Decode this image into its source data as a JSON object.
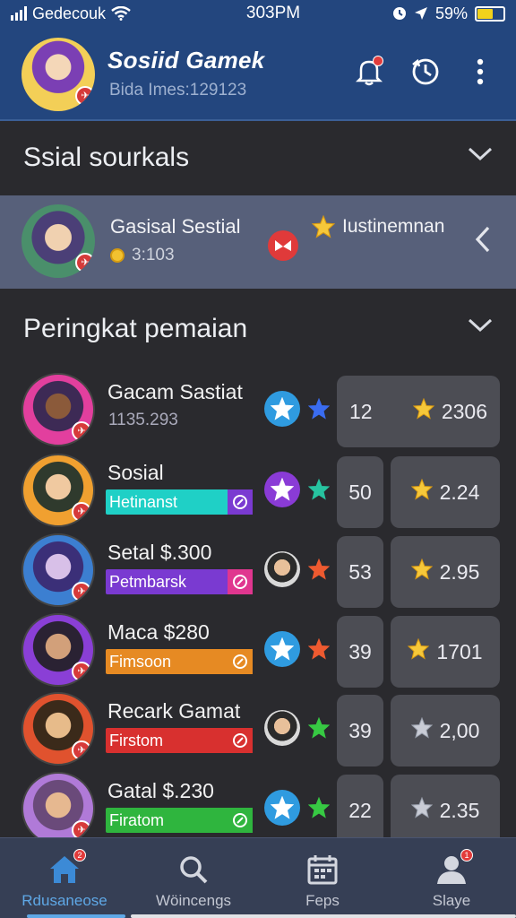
{
  "status_bar": {
    "carrier": "Gedecouk",
    "time": "303PM",
    "battery": "59%",
    "battery_level": 0.59
  },
  "header": {
    "title": "Sosiid Gamek",
    "subtitle": "Bida Imes:129123",
    "icons": [
      "bell-icon",
      "history-icon",
      "more-vertical-icon"
    ]
  },
  "sections": {
    "social": {
      "title": "Ssial sourkals"
    },
    "ranking": {
      "title": "Peringkat pemaian"
    }
  },
  "spotlight": {
    "name": "Gasisal Sestial",
    "coins": "3:103",
    "tag": "Iustinemnan"
  },
  "players": [
    {
      "name": "Gacam Sastiat",
      "sub": "1135.293",
      "tag": "",
      "tag_color": "",
      "rank_badge": "blue",
      "mini_star": "#3a6cf0",
      "num": "12",
      "score": "2306",
      "score_star": "gold",
      "combined": true
    },
    {
      "name": "Sosial",
      "sub": "",
      "tag": "Hetinanst",
      "tag_color": "#1fd0c6",
      "tag_end": "#7a3ad1",
      "rank_badge": "purple",
      "mini_star": "#27c3a0",
      "num": "50",
      "score": "2.24",
      "score_star": "gold",
      "combined": false
    },
    {
      "name": "Setal $.300",
      "sub": "",
      "tag": "Petmbarsk",
      "tag_color": "#7a3ad1",
      "tag_end": "#e0368f",
      "rank_badge": "avatar",
      "mini_star": "#ee5a30",
      "num": "53",
      "score": "2.95",
      "score_star": "gold",
      "combined": false
    },
    {
      "name": "Maca $280",
      "sub": "",
      "tag": "Fimsoon",
      "tag_color": "#e68a23",
      "tag_end": "#e68a23",
      "rank_badge": "blue",
      "mini_star": "#ee5a30",
      "num": "39",
      "score": "1701",
      "score_star": "gold",
      "combined": false
    },
    {
      "name": "Recark Gamat",
      "sub": "",
      "tag": "Firstom",
      "tag_color": "#d8302f",
      "tag_end": "#d8302f",
      "rank_badge": "avatar",
      "mini_star": "#37c943",
      "num": "39",
      "score": "2,00",
      "score_star": "silver",
      "combined": false
    },
    {
      "name": "Gatal $.230",
      "sub": "",
      "tag": "Firatom",
      "tag_color": "#2fb53e",
      "tag_end": "#2fb53e",
      "rank_badge": "blue",
      "mini_star": "#37c943",
      "num": "22",
      "score": "2.35",
      "score_star": "silver",
      "combined": false
    }
  ],
  "tabs": [
    {
      "label": "Rdusaneose",
      "icon": "home-icon",
      "badge": "2",
      "active": true
    },
    {
      "label": "Wöincengs",
      "icon": "search-icon",
      "badge": "",
      "active": false
    },
    {
      "label": "Feps",
      "icon": "calendar-icon",
      "badge": "",
      "active": false
    },
    {
      "label": "Slaye",
      "icon": "profile-icon",
      "badge": "1",
      "active": false
    }
  ],
  "colors": {
    "header_bg": "#23467e",
    "body_bg": "#2a2a2e",
    "spotlight_bg": "#57607a",
    "accent": "#5fa8e6"
  }
}
